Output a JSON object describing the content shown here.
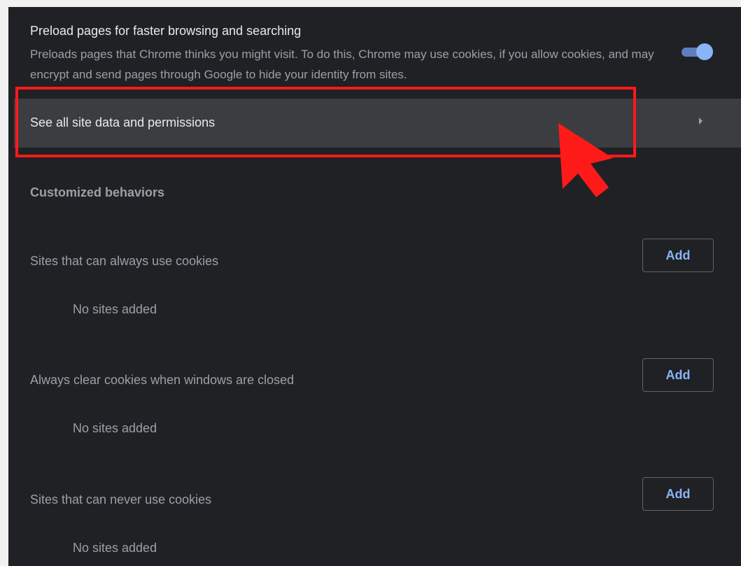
{
  "preload": {
    "title": "Preload pages for faster browsing and searching",
    "description": "Preloads pages that Chrome thinks you might visit. To do this, Chrome may use cookies, if you allow cookies, and may encrypt and send pages through Google to hide your identity from sites.",
    "toggle_on": true
  },
  "site_data_row": {
    "label": "See all site data and permissions",
    "icon": "chevron-right-icon"
  },
  "customized_behaviors": {
    "heading": "Customized behaviors",
    "groups": [
      {
        "label": "Sites that can always use cookies",
        "button": "Add",
        "empty": "No sites added"
      },
      {
        "label": "Always clear cookies when windows are closed",
        "button": "Add",
        "empty": "No sites added"
      },
      {
        "label": "Sites that can never use cookies",
        "button": "Add",
        "empty": "No sites added"
      }
    ]
  },
  "annotation": {
    "highlight_color": "#ff1a1a",
    "pointer_icon": "cursor-arrow-icon"
  },
  "colors": {
    "background": "#202124",
    "row_highlight": "#3c3d40",
    "primary_text": "#e8eaed",
    "secondary_text": "#9aa0a6",
    "accent": "#8ab4f8"
  }
}
